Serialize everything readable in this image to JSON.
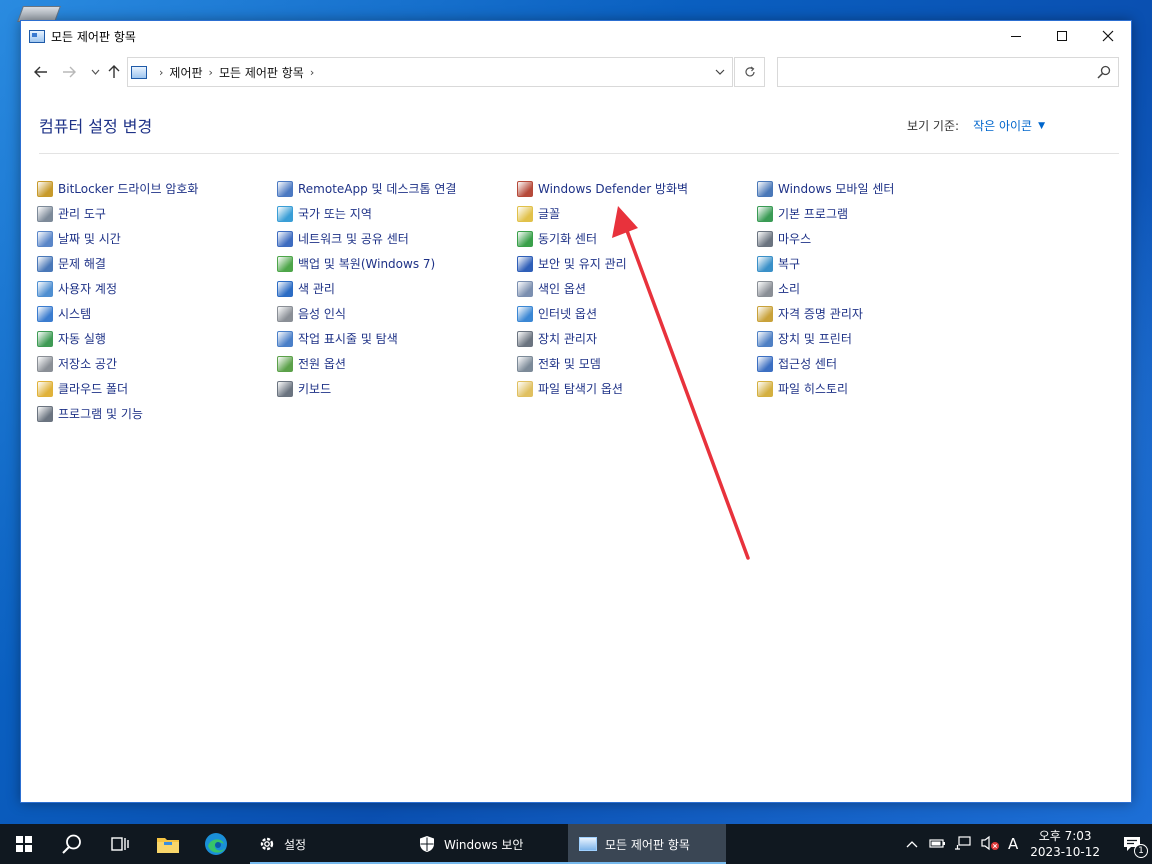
{
  "window": {
    "title": "모든 제어판 항목"
  },
  "address": {
    "crumbs": [
      "제어판",
      "모든 제어판 항목"
    ],
    "search_placeholder": ""
  },
  "header": {
    "title": "컴퓨터 설정 변경",
    "view_by_label": "보기 기준:",
    "view_by_value": "작은 아이콘"
  },
  "items": {
    "col1": [
      "BitLocker 드라이브 암호화",
      "관리 도구",
      "날짜 및 시간",
      "문제 해결",
      "사용자 계정",
      "시스템",
      "자동 실행",
      "저장소 공간",
      "클라우드 폴더",
      "프로그램 및 기능"
    ],
    "col2": [
      "RemoteApp 및 데스크톱 연결",
      "국가 또는 지역",
      "네트워크 및 공유 센터",
      "백업 및 복원(Windows 7)",
      "색 관리",
      "음성 인식",
      "작업 표시줄 및 탐색",
      "전원 옵션",
      "키보드"
    ],
    "col3": [
      "Windows Defender 방화벽",
      "글꼴",
      "동기화 센터",
      "보안 및 유지 관리",
      "색인 옵션",
      "인터넷 옵션",
      "장치 관리자",
      "전화 및 모뎀",
      "파일 탐색기 옵션"
    ],
    "col4": [
      "Windows 모바일 센터",
      "기본 프로그램",
      "마우스",
      "복구",
      "소리",
      "자격 증명 관리자",
      "장치 및 프린터",
      "접근성 센터",
      "파일 히스토리"
    ]
  },
  "icons": {
    "col1": [
      "lock-key-icon",
      "gear-tools-icon",
      "clock-icon",
      "troubleshoot-icon",
      "users-icon",
      "monitor-icon",
      "autoplay-icon",
      "storage-icon",
      "folder-cloud-icon",
      "programs-icon"
    ],
    "col2": [
      "remote-desktop-icon",
      "globe-icon",
      "network-icon",
      "backup-icon",
      "color-icon",
      "microphone-icon",
      "taskbar-icon",
      "power-icon",
      "keyboard-icon"
    ],
    "col3": [
      "firewall-icon",
      "font-icon",
      "sync-icon",
      "flag-icon",
      "index-icon",
      "internet-icon",
      "device-manager-icon",
      "phone-modem-icon",
      "folder-options-icon"
    ],
    "col4": [
      "mobility-icon",
      "default-programs-icon",
      "mouse-icon",
      "recovery-icon",
      "speaker-icon",
      "credential-icon",
      "printer-icon",
      "ease-of-access-icon",
      "file-history-icon"
    ]
  },
  "taskbar": {
    "apps": [
      {
        "label": "설정"
      },
      {
        "label": "Windows 보안"
      },
      {
        "label": "모든 제어판 항목"
      }
    ],
    "ime": "A",
    "time": "오후 7:03",
    "date": "2023-10-12",
    "notification_count": "1"
  },
  "colors": {
    "link": "#1e3287",
    "accent": "#0066cc",
    "arrow": "#e8323c",
    "taskbar": "#101820"
  }
}
